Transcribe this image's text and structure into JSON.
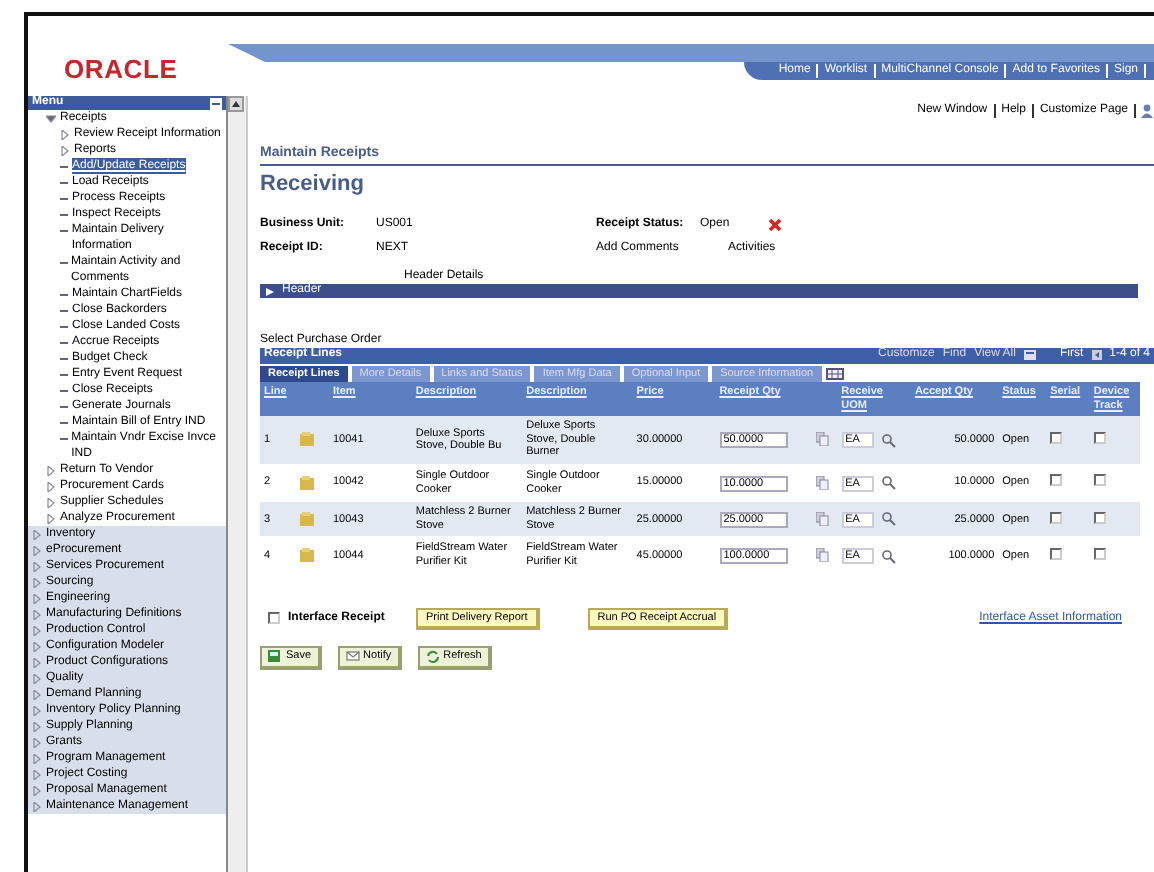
{
  "logo": "ORACLE",
  "top_links": [
    "Home",
    "Worklist",
    "MultiChannel Console",
    "Add to Favorites",
    "Sign"
  ],
  "menu": {
    "title": "Menu",
    "open_section": [
      {
        "label": "Receipts",
        "kind": "folder",
        "expanded": true,
        "children": [
          {
            "label": "Review Receipt Information",
            "kind": "folder",
            "expanded": false
          },
          {
            "label": "Reports",
            "kind": "folder",
            "expanded": false
          },
          {
            "label": "Add/Update Receipts",
            "kind": "link",
            "selected": true
          },
          {
            "label": "Load Receipts",
            "kind": "link",
            "selected": false
          },
          {
            "label": "Process Receipts",
            "kind": "link",
            "selected": false
          },
          {
            "label": "Inspect Receipts",
            "kind": "link",
            "selected": false
          },
          {
            "label": "Maintain Delivery Information",
            "kind": "link",
            "selected": false
          },
          {
            "label": "Maintain Activity and Comments",
            "kind": "link",
            "selected": false
          },
          {
            "label": "Maintain ChartFields",
            "kind": "link",
            "selected": false
          },
          {
            "label": "Close Backorders",
            "kind": "link",
            "selected": false
          },
          {
            "label": "Close Landed Costs",
            "kind": "link",
            "selected": false
          },
          {
            "label": "Accrue Receipts",
            "kind": "link",
            "selected": false
          },
          {
            "label": "Budget Check",
            "kind": "link",
            "selected": false
          },
          {
            "label": "Entry Event Request",
            "kind": "link",
            "selected": false
          },
          {
            "label": "Close Receipts",
            "kind": "link",
            "selected": false
          },
          {
            "label": "Generate Journals",
            "kind": "link",
            "selected": false
          },
          {
            "label": "Maintain Bill of Entry IND",
            "kind": "link",
            "selected": false
          },
          {
            "label": "Maintain Vndr Excise Invce IND",
            "kind": "link",
            "selected": false
          }
        ]
      },
      {
        "label": "Return To Vendor",
        "kind": "folder",
        "expanded": false
      },
      {
        "label": "Procurement Cards",
        "kind": "folder",
        "expanded": false
      },
      {
        "label": "Supplier Schedules",
        "kind": "folder",
        "expanded": false
      },
      {
        "label": "Analyze Procurement",
        "kind": "folder",
        "expanded": false
      }
    ],
    "items": [
      {
        "label": "Inventory",
        "kind": "folder",
        "expanded": false
      },
      {
        "label": "eProcurement",
        "kind": "folder",
        "expanded": false
      },
      {
        "label": "Services Procurement",
        "kind": "folder",
        "expanded": false
      },
      {
        "label": "Sourcing",
        "kind": "folder",
        "expanded": false
      },
      {
        "label": "Engineering",
        "kind": "folder",
        "expanded": false
      },
      {
        "label": "Manufacturing Definitions",
        "kind": "folder",
        "expanded": false
      },
      {
        "label": "Production Control",
        "kind": "folder",
        "expanded": false
      },
      {
        "label": "Configuration Modeler",
        "kind": "folder",
        "expanded": false
      },
      {
        "label": "Product Configurations",
        "kind": "folder",
        "expanded": false
      },
      {
        "label": "Quality",
        "kind": "folder",
        "expanded": false
      },
      {
        "label": "Demand Planning",
        "kind": "folder",
        "expanded": false
      },
      {
        "label": "Inventory Policy Planning",
        "kind": "folder",
        "expanded": false
      },
      {
        "label": "Supply Planning",
        "kind": "folder",
        "expanded": false
      },
      {
        "label": "Grants",
        "kind": "folder",
        "expanded": false
      },
      {
        "label": "Program Management",
        "kind": "folder",
        "expanded": false
      },
      {
        "label": "Project Costing",
        "kind": "folder",
        "expanded": false
      },
      {
        "label": "Proposal Management",
        "kind": "folder",
        "expanded": false
      },
      {
        "label": "Maintenance Management",
        "kind": "folder",
        "expanded": false
      }
    ]
  },
  "page_links": [
    "New Window",
    "Help",
    "Customize Page"
  ],
  "breadcrumb": "Maintain Receipts",
  "title": "Receiving",
  "fields": [
    {
      "label": "Business Unit:",
      "value": "US001"
    },
    {
      "label": "Receipt ID:",
      "value": "NEXT"
    }
  ],
  "receipt_status": {
    "label": "Receipt Status:",
    "value": "Open"
  },
  "links": [
    "Add Comments",
    "Activities"
  ],
  "header_details": "Header Details",
  "header_section": {
    "label": "Header",
    "expanded": false
  },
  "select_po": "Select Purchase Order",
  "grid": {
    "title": "Receipt Lines",
    "nav_links": [
      "Customize",
      "Find",
      "View All"
    ],
    "first": "First",
    "range": "1-4 of 4",
    "tabs": [
      {
        "label": "Receipt Lines",
        "selected": true
      },
      {
        "label": "More Details",
        "selected": false
      },
      {
        "label": "Links and Status",
        "selected": false
      },
      {
        "label": "Item Mfg Data",
        "selected": false
      },
      {
        "label": "Optional Input",
        "selected": false
      },
      {
        "label": "Source Information",
        "selected": false
      }
    ],
    "columns": [
      "Line",
      "Item",
      "Description",
      "Description",
      "Price",
      "Receipt Qty",
      "Receive UOM",
      "Accept Qty",
      "Status",
      "Serial",
      "Device Track"
    ],
    "rows": [
      {
        "line": "1",
        "item": "10041",
        "description_link": "Deluxe Sports Stove, Double Bu",
        "description": "Deluxe Sports Stove, Double Burner",
        "price": "30.00000",
        "receipt_qty": "50.0000",
        "uom": "EA",
        "accept_qty": "50.0000",
        "status": "Open",
        "serial": false,
        "device_track": false
      },
      {
        "line": "2",
        "item": "10042",
        "description_link": "Single Outdoor Cooker",
        "description": "Single Outdoor Cooker",
        "price": "15.00000",
        "receipt_qty": "10.0000",
        "uom": "EA",
        "accept_qty": "10.0000",
        "status": "Open",
        "serial": false,
        "device_track": false
      },
      {
        "line": "3",
        "item": "10043",
        "description_link": "Matchless 2 Burner Stove",
        "description": "Matchless 2 Burner Stove",
        "price": "25.00000",
        "receipt_qty": "25.0000",
        "uom": "EA",
        "accept_qty": "25.0000",
        "status": "Open",
        "serial": false,
        "device_track": false
      },
      {
        "line": "4",
        "item": "10044",
        "description_link": "FieldStream Water Purifier Kit",
        "description": "FieldStream Water Purifier Kit",
        "price": "45.00000",
        "receipt_qty": "100.0000",
        "uom": "EA",
        "accept_qty": "100.0000",
        "status": "Open",
        "serial": false,
        "device_track": false
      }
    ]
  },
  "interface_receipt": {
    "label": "Interface Receipt",
    "checked": false
  },
  "action_buttons": [
    "Print Delivery Report",
    "Run PO Receipt Accrual"
  ],
  "asset_link": "Interface Asset Information",
  "toolbar": [
    {
      "label": "Save",
      "kind": "save"
    },
    {
      "label": "Notify",
      "kind": "notify"
    },
    {
      "label": "Refresh",
      "kind": "refresh"
    }
  ]
}
